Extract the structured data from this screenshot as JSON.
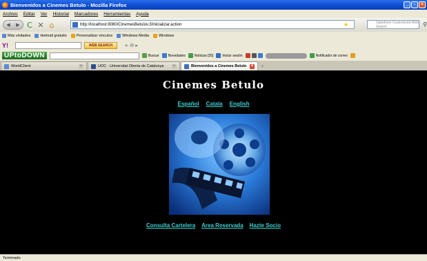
{
  "window": {
    "title": "Bienvenidos a Cinemes Betulo - Mozilla Firefox"
  },
  "menu": [
    "Archivo",
    "Editar",
    "Ver",
    "Historial",
    "Marcadores",
    "Herramientas",
    "Ayuda"
  ],
  "navigation": {
    "url": "http://localhost:8080/CinemesBetulov.3/inicializar.action",
    "search_placeholder": "Uptodown Customized Web Search"
  },
  "bookmarks": [
    "Más visitados",
    "Hotmail gratuito",
    "Personalizar vínculos",
    "Windows Media",
    "Windows"
  ],
  "yahoo_toolbar": {
    "logo": "Y!",
    "button": "WEB SEARCH"
  },
  "uptodown_toolbar": {
    "logo": "UPtoDOWN",
    "items": [
      "Buscar",
      "Novedades",
      "Noticias [35]",
      "Iniciar sesión",
      "Notificador de correo"
    ]
  },
  "tabs": [
    {
      "label": "WorldClient",
      "active": false
    },
    {
      "label": "UOC - Universitat Oberta de Catalunya",
      "active": false
    },
    {
      "label": "Bienvenidos a Cinemes Betulo",
      "active": true
    }
  ],
  "page": {
    "title": "Cinemes Betulo",
    "languages": [
      "Español",
      "Catala",
      "English"
    ],
    "links": [
      "Consulta Cartelera",
      "Area Reservada",
      "Hazte Socio"
    ]
  },
  "status": "Terminado",
  "colors": {
    "link": "#3fd0d0",
    "background": "#000000",
    "titlebar": "#0a4bd0"
  }
}
